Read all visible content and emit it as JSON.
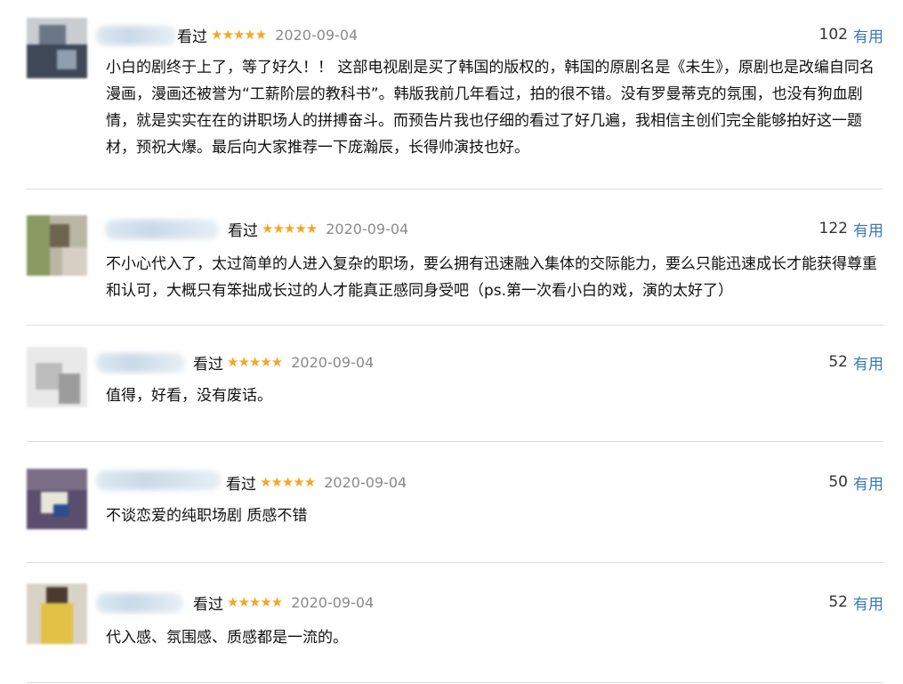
{
  "reviews": [
    {
      "status": "看过",
      "stars": "★★★★★",
      "date": "2020-09-04",
      "useful_count": "102",
      "useful_label": "有用",
      "content": "小白的剧终于上了，等了好久！！ 这部电视剧是买了韩国的版权的，韩国的原剧名是《未生》，原剧也是改编自同名漫画，漫画还被誉为“工薪阶层的教科书”。韩版我前几年看过，拍的很不错。没有罗曼蒂克的氛围，也没有狗血剧情，就是实实在在的讲职场人的拼搏奋斗。而预告片我也仔细的看过了好几遍，我相信主创们完全能够拍好这一题材，预祝大爆。最后向大家推荐一下庞瀚辰，长得帅演技也好。"
    },
    {
      "status": "看过",
      "stars": "★★★★★",
      "date": "2020-09-04",
      "useful_count": "122",
      "useful_label": "有用",
      "content": "不小心代入了，太过简单的人进入复杂的职场，要么拥有迅速融入集体的交际能力，要么只能迅速成长才能获得尊重和认可，大概只有笨拙成长过的人才能真正感同身受吧（ps.第一次看小白的戏，演的太好了）"
    },
    {
      "status": "看过",
      "stars": "★★★★★",
      "date": "2020-09-04",
      "useful_count": "52",
      "useful_label": "有用",
      "content": "值得，好看，没有废话。"
    },
    {
      "status": "看过",
      "stars": "★★★★★",
      "date": "2020-09-04",
      "useful_count": "50",
      "useful_label": "有用",
      "content": "不谈恋爱的纯职场剧 质感不错"
    },
    {
      "status": "看过",
      "stars": "★★★★★",
      "date": "2020-09-04",
      "useful_count": "52",
      "useful_label": "有用",
      "content": "代入感、氛围感、质感都是一流的。"
    }
  ],
  "colors": {
    "star": "#f5a623",
    "link": "#3a7ab5",
    "date": "#8a8a8a",
    "divider": "#dcdcdc"
  }
}
